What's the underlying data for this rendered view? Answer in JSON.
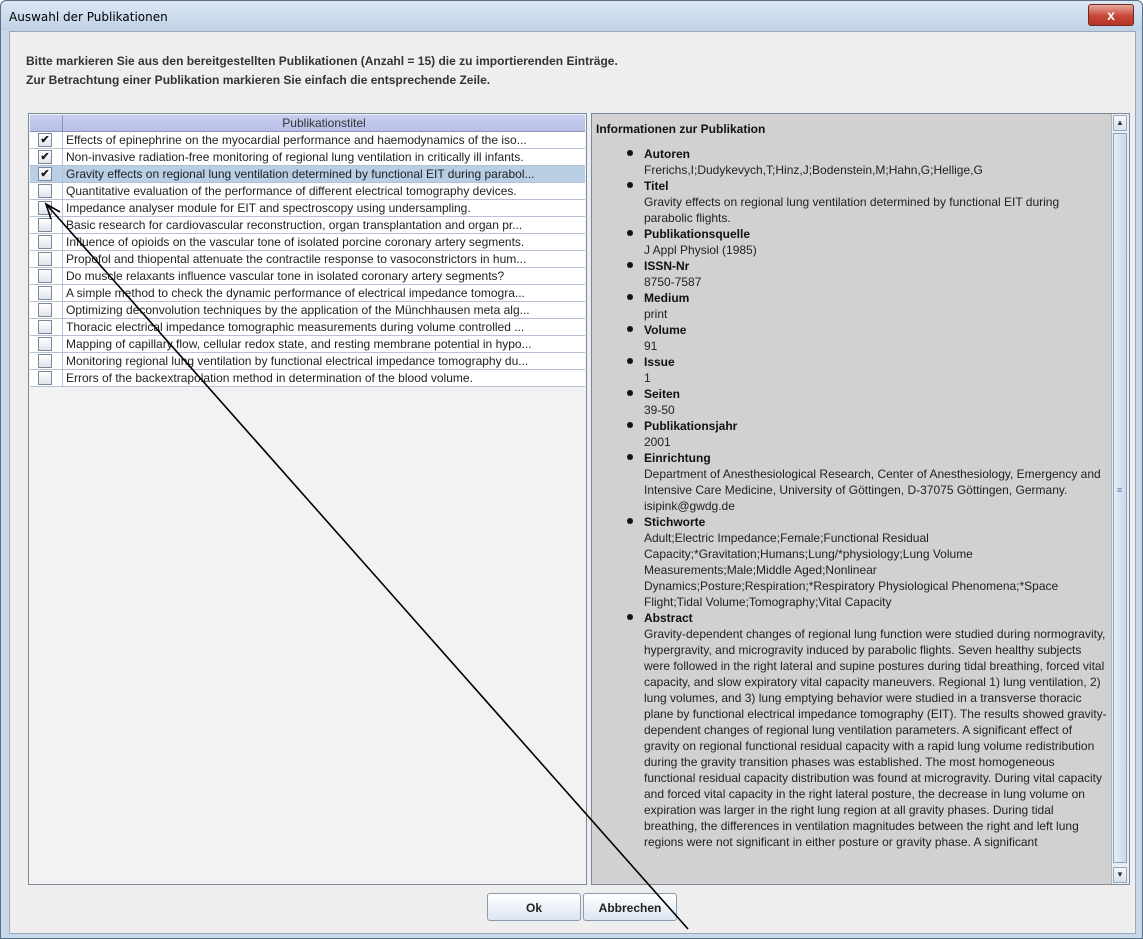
{
  "window": {
    "title": "Auswahl der Publikationen",
    "close_glyph": "x"
  },
  "instructions": {
    "line1": "Bitte markieren Sie aus den bereitgestellten Publikationen (Anzahl = 15) die zu importierenden Einträge.",
    "line2": "Zur Betrachtung einer Publikation markieren Sie einfach die entsprechende Zeile."
  },
  "table": {
    "column_header": "Publikationstitel",
    "rows": [
      {
        "checked": true,
        "selected": false,
        "title": "Effects of epinephrine on the myocardial performance and haemodynamics of the iso..."
      },
      {
        "checked": true,
        "selected": false,
        "title": "Non-invasive radiation-free monitoring of regional lung ventilation in critically ill infants."
      },
      {
        "checked": true,
        "selected": true,
        "title": "Gravity effects on regional lung ventilation determined by functional EIT during parabol..."
      },
      {
        "checked": false,
        "selected": false,
        "title": "Quantitative evaluation of the performance of different electrical tomography devices."
      },
      {
        "checked": false,
        "selected": false,
        "title": "Impedance analyser module for EIT and spectroscopy using undersampling."
      },
      {
        "checked": false,
        "selected": false,
        "title": "Basic research for cardiovascular reconstruction, organ transplantation and organ pr..."
      },
      {
        "checked": false,
        "selected": false,
        "title": "Influence of opioids on the vascular tone of isolated porcine coronary artery segments."
      },
      {
        "checked": false,
        "selected": false,
        "title": "Propofol and thiopental attenuate the contractile response to vasoconstrictors in hum..."
      },
      {
        "checked": false,
        "selected": false,
        "title": "Do muscle relaxants influence vascular tone in isolated coronary artery segments?"
      },
      {
        "checked": false,
        "selected": false,
        "title": "A simple method to check the dynamic performance of electrical impedance tomogra..."
      },
      {
        "checked": false,
        "selected": false,
        "title": "Optimizing deconvolution techniques by the application of the Münchhausen meta alg..."
      },
      {
        "checked": false,
        "selected": false,
        "title": "Thoracic electrical impedance tomographic measurements during volume controlled ..."
      },
      {
        "checked": false,
        "selected": false,
        "title": "Mapping of capillary flow, cellular redox state, and resting membrane potential in hypo..."
      },
      {
        "checked": false,
        "selected": false,
        "title": "Monitoring regional lung ventilation by functional electrical impedance tomography du..."
      },
      {
        "checked": false,
        "selected": false,
        "title": "Errors of the backextrapolation method in determination of the blood volume."
      }
    ]
  },
  "info": {
    "heading": "Informationen zur Publikation",
    "fields": [
      {
        "label": "Autoren",
        "value": "Frerichs,I;Dudykevych,T;Hinz,J;Bodenstein,M;Hahn,G;Hellige,G"
      },
      {
        "label": "Titel",
        "value": "Gravity effects on regional lung ventilation determined by functional EIT during parabolic flights."
      },
      {
        "label": "Publikationsquelle",
        "value": "J Appl Physiol (1985)"
      },
      {
        "label": "ISSN-Nr",
        "value": "8750-7587"
      },
      {
        "label": "Medium",
        "value": "print"
      },
      {
        "label": "Volume",
        "value": "91"
      },
      {
        "label": "Issue",
        "value": "1"
      },
      {
        "label": "Seiten",
        "value": "39-50"
      },
      {
        "label": "Publikationsjahr",
        "value": "2001"
      },
      {
        "label": "Einrichtung",
        "value": "Department of Anesthesiological Research, Center of Anesthesiology, Emergency and Intensive Care Medicine, University of Göttingen, D-37075 Göttingen, Germany. isipink@gwdg.de"
      },
      {
        "label": "Stichworte",
        "value": "Adult;Electric Impedance;Female;Functional Residual Capacity;*Gravitation;Humans;Lung/*physiology;Lung Volume Measurements;Male;Middle Aged;Nonlinear Dynamics;Posture;Respiration;*Respiratory Physiological Phenomena;*Space Flight;Tidal Volume;Tomography;Vital Capacity"
      },
      {
        "label": "Abstract",
        "value": "Gravity-dependent changes of regional lung function were studied during normogravity, hypergravity, and microgravity induced by parabolic flights. Seven healthy subjects were followed in the right lateral and supine postures during tidal breathing, forced vital capacity, and slow expiratory vital capacity maneuvers. Regional 1) lung ventilation, 2) lung volumes, and 3) lung emptying behavior were studied in a transverse thoracic plane by functional electrical impedance tomography (EIT). The results showed gravity-dependent changes of regional lung ventilation parameters. A significant effect of gravity on regional functional residual capacity with a rapid lung volume redistribution during the gravity transition phases was established. The most homogeneous functional residual capacity distribution was found at microgravity. During vital capacity and forced vital capacity in the right lateral posture, the decrease in lung volume on expiration was larger in the right lung region at all gravity phases. During tidal breathing, the differences in ventilation magnitudes between the right and left lung regions were not significant in either posture or gravity phase. A significant"
      }
    ]
  },
  "buttons": {
    "ok": "Ok",
    "cancel": "Abbrechen"
  },
  "glyphs": {
    "checkmark": "✔",
    "scroll_up": "▲",
    "scroll_down": "▼",
    "scroll_grip": "≡"
  }
}
